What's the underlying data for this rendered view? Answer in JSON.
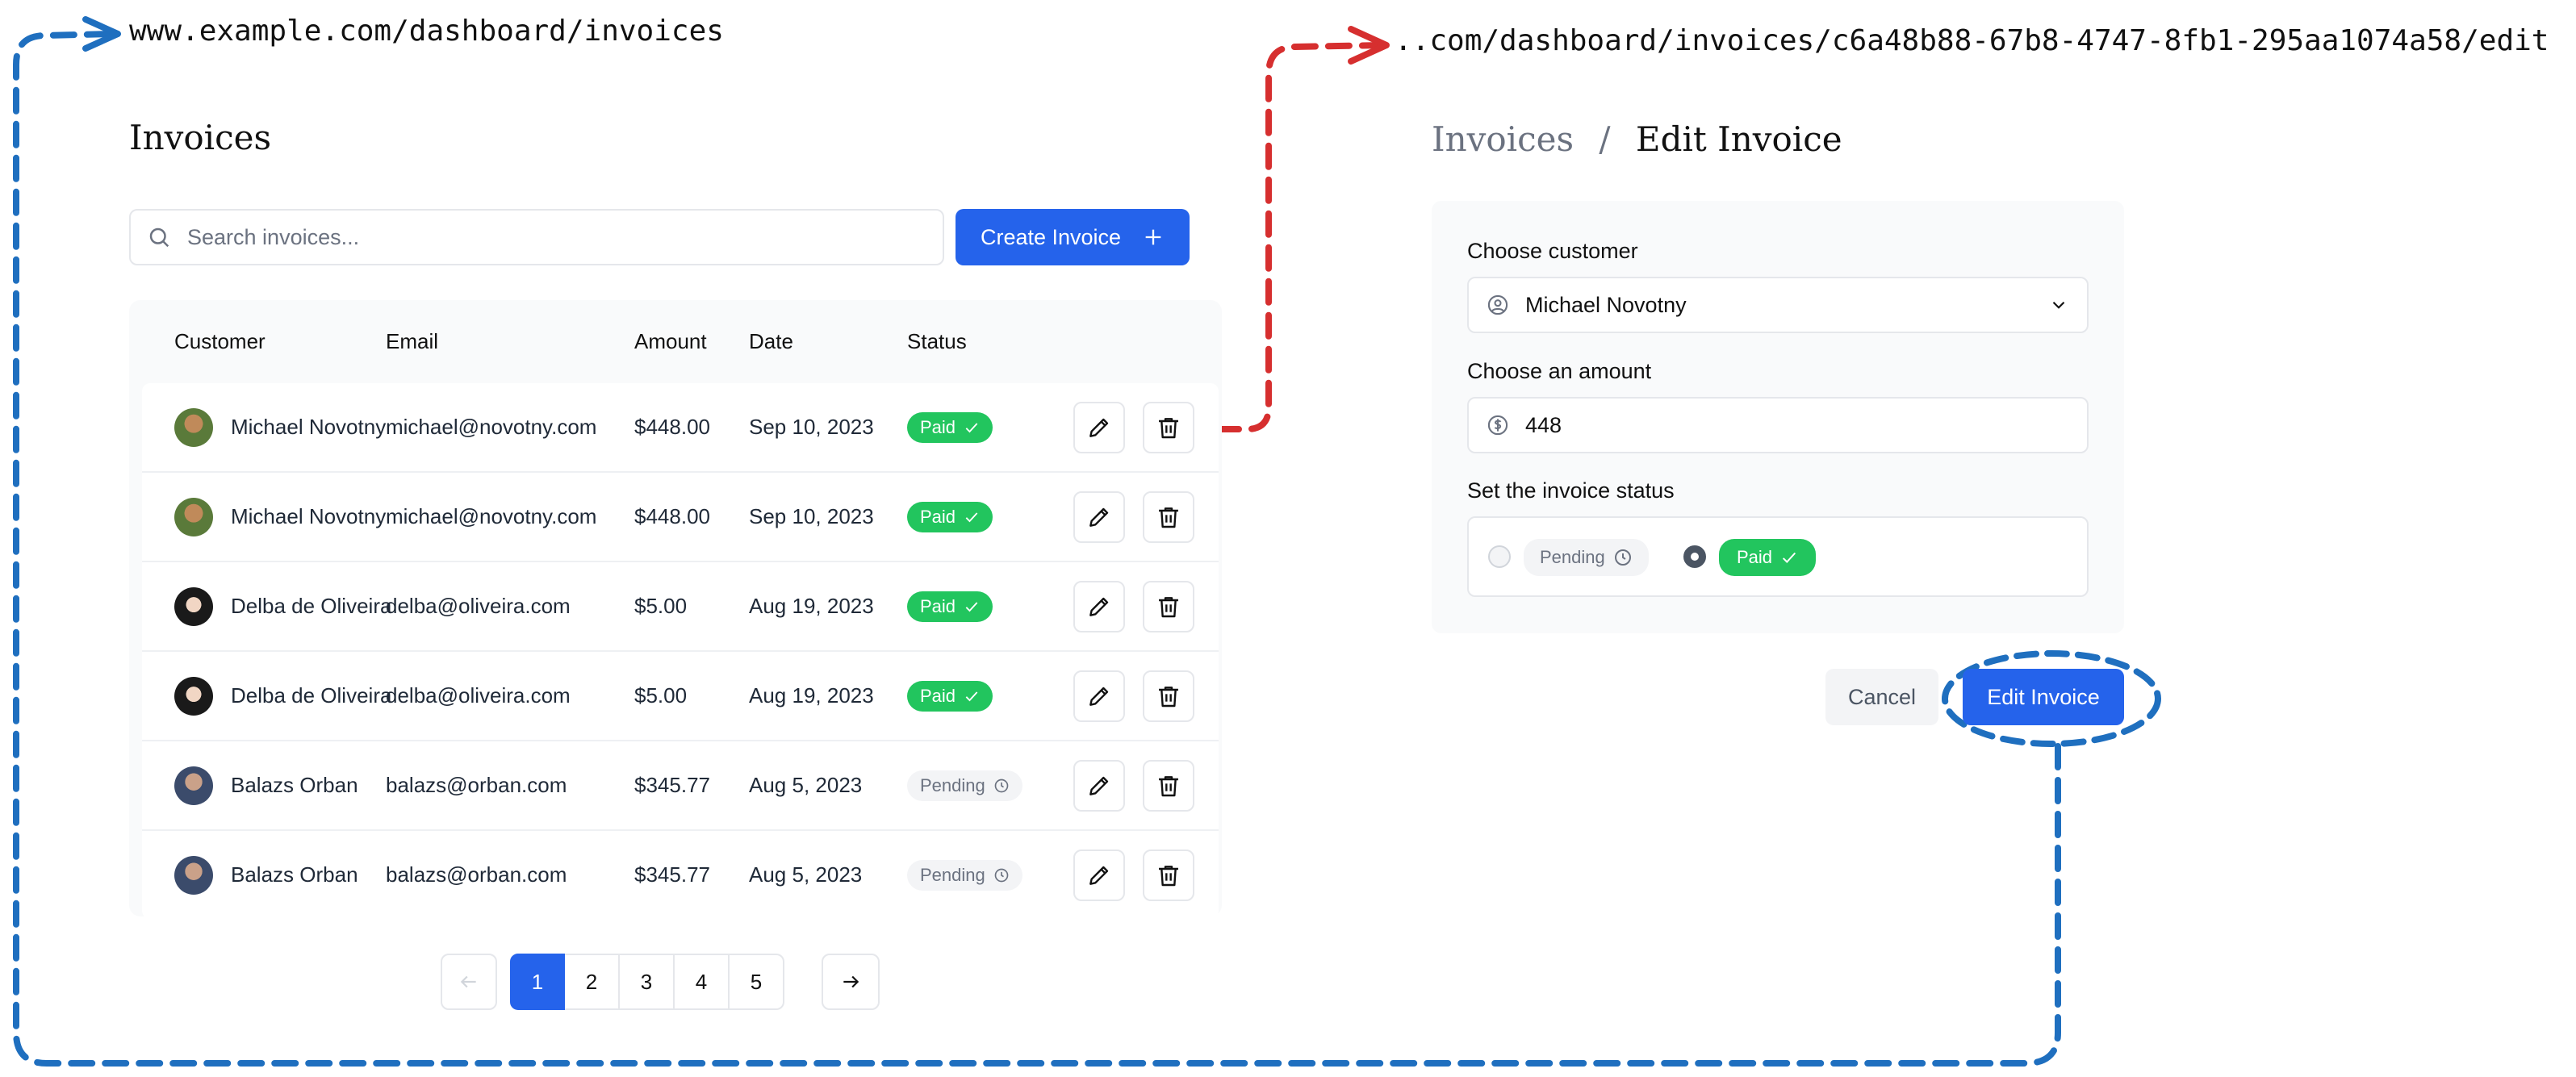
{
  "urls": {
    "list": "www.example.com/dashboard/invoices",
    "edit": "..com/dashboard/invoices/c6a48b88-67b8-4747-8fb1-295aa1074a58/edit"
  },
  "list_page": {
    "title": "Invoices",
    "search_placeholder": "Search invoices...",
    "create_button": "Create Invoice",
    "columns": [
      "Customer",
      "Email",
      "Amount",
      "Date",
      "Status"
    ],
    "rows": [
      {
        "customer": "Michael Novotny",
        "email": "michael@novotny.com",
        "amount": "$448.00",
        "date": "Sep 10, 2023",
        "status": "Paid"
      },
      {
        "customer": "Michael Novotny",
        "email": "michael@novotny.com",
        "amount": "$448.00",
        "date": "Sep 10, 2023",
        "status": "Paid"
      },
      {
        "customer": "Delba de Oliveira",
        "email": "delba@oliveira.com",
        "amount": "$5.00",
        "date": "Aug 19, 2023",
        "status": "Paid"
      },
      {
        "customer": "Delba de Oliveira",
        "email": "delba@oliveira.com",
        "amount": "$5.00",
        "date": "Aug 19, 2023",
        "status": "Paid"
      },
      {
        "customer": "Balazs Orban",
        "email": "balazs@orban.com",
        "amount": "$345.77",
        "date": "Aug 5, 2023",
        "status": "Pending"
      },
      {
        "customer": "Balazs Orban",
        "email": "balazs@orban.com",
        "amount": "$345.77",
        "date": "Aug 5, 2023",
        "status": "Pending"
      }
    ],
    "pagination": {
      "pages": [
        "1",
        "2",
        "3",
        "4",
        "5"
      ],
      "current": "1"
    }
  },
  "edit_page": {
    "breadcrumb_parent": "Invoices",
    "breadcrumb_separator": "/",
    "breadcrumb_current": "Edit Invoice",
    "customer_label": "Choose customer",
    "customer_value": "Michael Novotny",
    "amount_label": "Choose an amount",
    "amount_value": "448",
    "status_label": "Set the invoice status",
    "status_options": [
      "Pending",
      "Paid"
    ],
    "status_selected": "Paid",
    "cancel_button": "Cancel",
    "submit_button": "Edit Invoice"
  },
  "colors": {
    "primary": "#2563eb",
    "paid": "#22c55e",
    "annotation_blue": "#1f6fbf",
    "annotation_red": "#d62f2f"
  },
  "icons": [
    "search-icon",
    "plus-icon",
    "pencil-icon",
    "trash-icon",
    "clock-icon",
    "check-icon",
    "user-circle-icon",
    "dollar-icon",
    "chevron-down-icon",
    "arrow-left-icon",
    "arrow-right-icon"
  ]
}
